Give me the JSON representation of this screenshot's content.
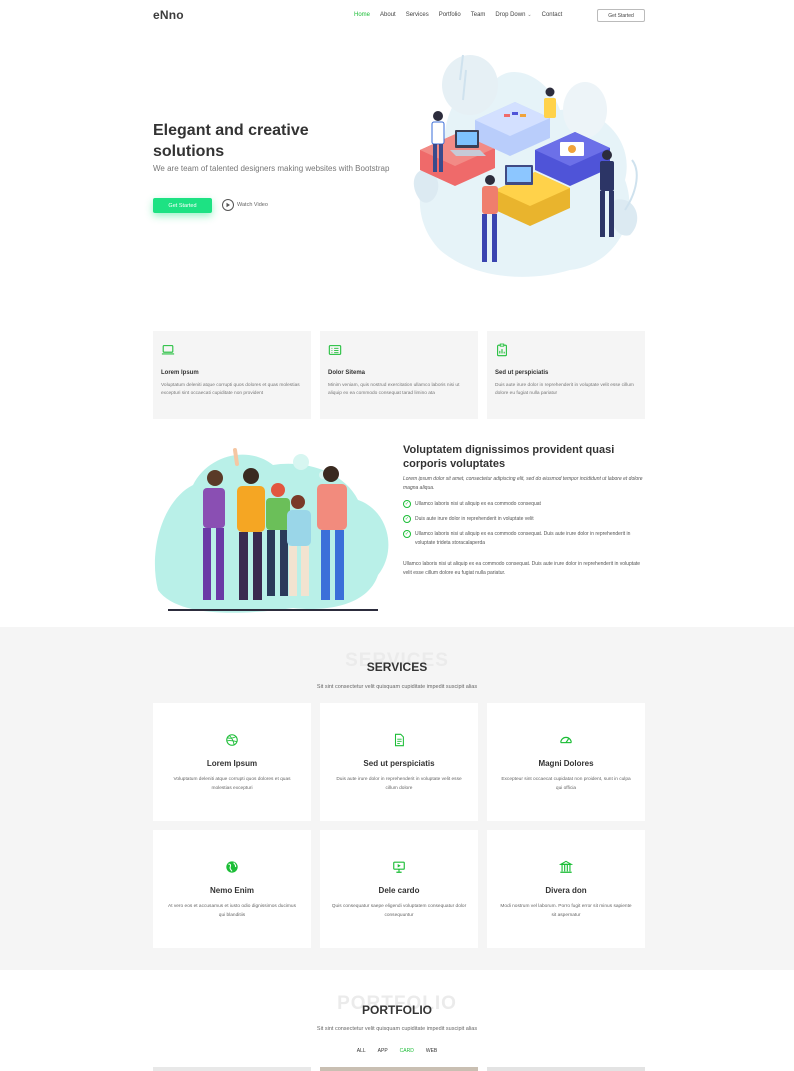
{
  "brand": "eNno",
  "nav": {
    "items": [
      "Home",
      "About",
      "Services",
      "Portfolio",
      "Team",
      "Drop Down",
      "Contact"
    ],
    "cta": "Get Started"
  },
  "hero": {
    "title": "Elegant and creative solutions",
    "subtitle": "We are team of talented designers making websites with Bootstrap",
    "primary_button": "Get Started",
    "video_link": "Watch Video"
  },
  "features": [
    {
      "icon": "laptop-icon",
      "title": "Lorem Ipsum",
      "text": "Voluptatum deleniti atque corrupti quos dolores et quas molestias excepturi sint occaecati cupiditate non provident"
    },
    {
      "icon": "card-list-icon",
      "title": "Dolor Sitema",
      "text": "Minim veniam, quis nostrud exercitation ullamco laboris nisi ut aliquip ex ea commodo consequat tarad limino ata"
    },
    {
      "icon": "clipboard-data-icon",
      "title": "Sed ut perspiciatis",
      "text": "Duis aute irure dolor in reprehenderit in voluptate velit esse cillum dolore eu fugiat nulla pariatur"
    }
  ],
  "about": {
    "title": "Voluptatem dignissimos provident quasi corporis voluptates",
    "lead": "Lorem ipsum dolor sit amet, consectetur adipiscing elit, sed do eiusmod tempor incididunt ut labore et dolore magna aliqua.",
    "checks": [
      "Ullamco laboris nisi ut aliquip ex ea commodo consequat",
      "Duis aute irure dolor in reprehenderit in voluptate velit",
      "Ullamco laboris nisi ut aliquip ex ea commodo consequat. Duis aute irure dolor in reprehenderit in voluptate trideta storacalaperda"
    ],
    "paragraph": "Ullamco laboris nisi ut aliquip ex ea commodo consequat. Duis aute irure dolor in reprehenderit in voluptate velit esse cillum dolore eu fugiat nulla pariatur."
  },
  "services": {
    "ghost": "SERVICES",
    "title": "SERVICES",
    "subtitle": "Sit sint consectetur velit quisquam cupiditate impedit suscipit alias",
    "items": [
      {
        "icon": "dribbble-icon",
        "title": "Lorem Ipsum",
        "text": "Voluptatum deleniti atque corrupti quos dolores et quas molestias excepturi"
      },
      {
        "icon": "file-text-icon",
        "title": "Sed ut perspiciatis",
        "text": "Duis aute irure dolor in reprehenderit in voluptate velit esse cillum dolore"
      },
      {
        "icon": "speedometer-icon",
        "title": "Magni Dolores",
        "text": "Excepteur sint occaecat cupidatat non proident, sunt in culpa qui officia"
      },
      {
        "icon": "globe-icon",
        "title": "Nemo Enim",
        "text": "At vero eos et accusamus et iusto odio dignissimos ducimus qui blanditiis"
      },
      {
        "icon": "easel-icon",
        "title": "Dele cardo",
        "text": "Quis consequatur saepe eligendi voluptatem consequatur dolor consequuntur"
      },
      {
        "icon": "bank-icon",
        "title": "Divera don",
        "text": "Modi nostrum vel laborum. Porro fugit error sit minus sapiente sit aspernatur"
      }
    ]
  },
  "portfolio": {
    "ghost": "PORTFOLIO",
    "title": "PORTFOLIO",
    "subtitle": "Sit sint consectetur velit quisquam cupiditate impedit suscipit alias",
    "filters": [
      "ALL",
      "APP",
      "CARD",
      "WEB"
    ],
    "active_filter": "CARD"
  },
  "colors": {
    "accent": "#1bbd36",
    "button": "#1de283",
    "section_bg": "#f5f5f5"
  }
}
